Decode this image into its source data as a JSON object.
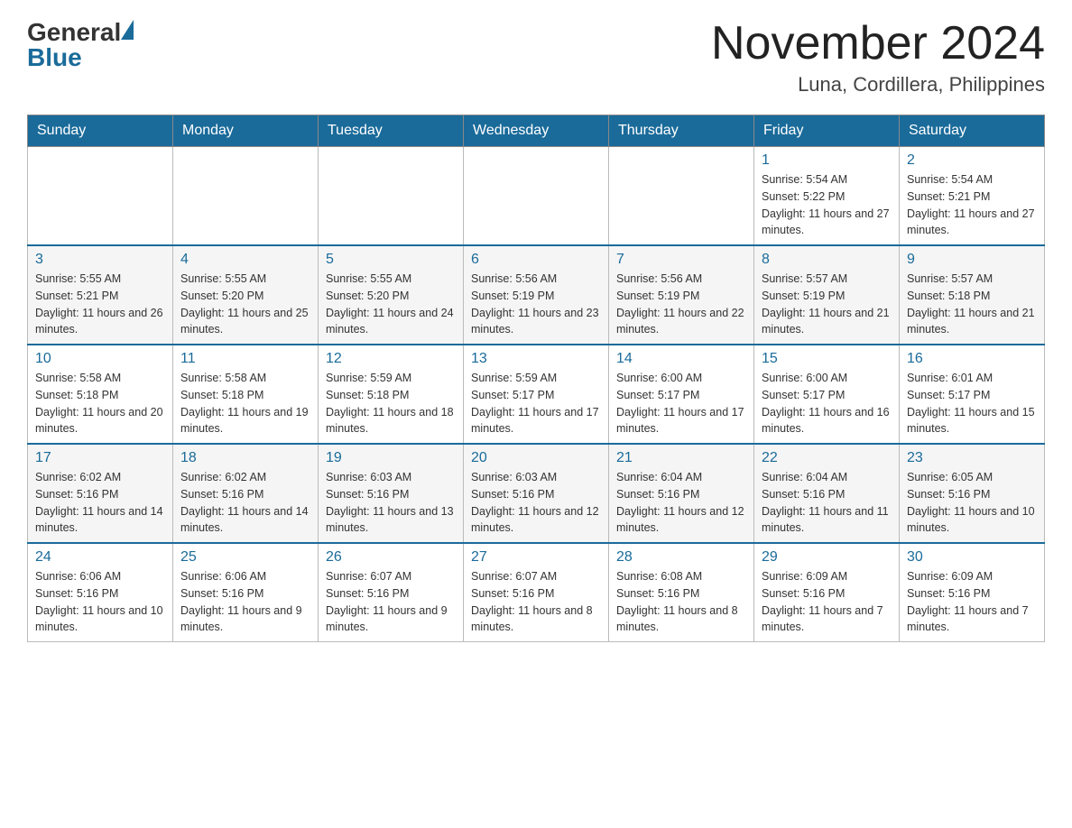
{
  "header": {
    "logo_general": "General",
    "logo_blue": "Blue",
    "month_title": "November 2024",
    "location": "Luna, Cordillera, Philippines"
  },
  "calendar": {
    "days_of_week": [
      "Sunday",
      "Monday",
      "Tuesday",
      "Wednesday",
      "Thursday",
      "Friday",
      "Saturday"
    ],
    "weeks": [
      [
        {
          "day": "",
          "info": ""
        },
        {
          "day": "",
          "info": ""
        },
        {
          "day": "",
          "info": ""
        },
        {
          "day": "",
          "info": ""
        },
        {
          "day": "",
          "info": ""
        },
        {
          "day": "1",
          "info": "Sunrise: 5:54 AM\nSunset: 5:22 PM\nDaylight: 11 hours and 27 minutes."
        },
        {
          "day": "2",
          "info": "Sunrise: 5:54 AM\nSunset: 5:21 PM\nDaylight: 11 hours and 27 minutes."
        }
      ],
      [
        {
          "day": "3",
          "info": "Sunrise: 5:55 AM\nSunset: 5:21 PM\nDaylight: 11 hours and 26 minutes."
        },
        {
          "day": "4",
          "info": "Sunrise: 5:55 AM\nSunset: 5:20 PM\nDaylight: 11 hours and 25 minutes."
        },
        {
          "day": "5",
          "info": "Sunrise: 5:55 AM\nSunset: 5:20 PM\nDaylight: 11 hours and 24 minutes."
        },
        {
          "day": "6",
          "info": "Sunrise: 5:56 AM\nSunset: 5:19 PM\nDaylight: 11 hours and 23 minutes."
        },
        {
          "day": "7",
          "info": "Sunrise: 5:56 AM\nSunset: 5:19 PM\nDaylight: 11 hours and 22 minutes."
        },
        {
          "day": "8",
          "info": "Sunrise: 5:57 AM\nSunset: 5:19 PM\nDaylight: 11 hours and 21 minutes."
        },
        {
          "day": "9",
          "info": "Sunrise: 5:57 AM\nSunset: 5:18 PM\nDaylight: 11 hours and 21 minutes."
        }
      ],
      [
        {
          "day": "10",
          "info": "Sunrise: 5:58 AM\nSunset: 5:18 PM\nDaylight: 11 hours and 20 minutes."
        },
        {
          "day": "11",
          "info": "Sunrise: 5:58 AM\nSunset: 5:18 PM\nDaylight: 11 hours and 19 minutes."
        },
        {
          "day": "12",
          "info": "Sunrise: 5:59 AM\nSunset: 5:18 PM\nDaylight: 11 hours and 18 minutes."
        },
        {
          "day": "13",
          "info": "Sunrise: 5:59 AM\nSunset: 5:17 PM\nDaylight: 11 hours and 17 minutes."
        },
        {
          "day": "14",
          "info": "Sunrise: 6:00 AM\nSunset: 5:17 PM\nDaylight: 11 hours and 17 minutes."
        },
        {
          "day": "15",
          "info": "Sunrise: 6:00 AM\nSunset: 5:17 PM\nDaylight: 11 hours and 16 minutes."
        },
        {
          "day": "16",
          "info": "Sunrise: 6:01 AM\nSunset: 5:17 PM\nDaylight: 11 hours and 15 minutes."
        }
      ],
      [
        {
          "day": "17",
          "info": "Sunrise: 6:02 AM\nSunset: 5:16 PM\nDaylight: 11 hours and 14 minutes."
        },
        {
          "day": "18",
          "info": "Sunrise: 6:02 AM\nSunset: 5:16 PM\nDaylight: 11 hours and 14 minutes."
        },
        {
          "day": "19",
          "info": "Sunrise: 6:03 AM\nSunset: 5:16 PM\nDaylight: 11 hours and 13 minutes."
        },
        {
          "day": "20",
          "info": "Sunrise: 6:03 AM\nSunset: 5:16 PM\nDaylight: 11 hours and 12 minutes."
        },
        {
          "day": "21",
          "info": "Sunrise: 6:04 AM\nSunset: 5:16 PM\nDaylight: 11 hours and 12 minutes."
        },
        {
          "day": "22",
          "info": "Sunrise: 6:04 AM\nSunset: 5:16 PM\nDaylight: 11 hours and 11 minutes."
        },
        {
          "day": "23",
          "info": "Sunrise: 6:05 AM\nSunset: 5:16 PM\nDaylight: 11 hours and 10 minutes."
        }
      ],
      [
        {
          "day": "24",
          "info": "Sunrise: 6:06 AM\nSunset: 5:16 PM\nDaylight: 11 hours and 10 minutes."
        },
        {
          "day": "25",
          "info": "Sunrise: 6:06 AM\nSunset: 5:16 PM\nDaylight: 11 hours and 9 minutes."
        },
        {
          "day": "26",
          "info": "Sunrise: 6:07 AM\nSunset: 5:16 PM\nDaylight: 11 hours and 9 minutes."
        },
        {
          "day": "27",
          "info": "Sunrise: 6:07 AM\nSunset: 5:16 PM\nDaylight: 11 hours and 8 minutes."
        },
        {
          "day": "28",
          "info": "Sunrise: 6:08 AM\nSunset: 5:16 PM\nDaylight: 11 hours and 8 minutes."
        },
        {
          "day": "29",
          "info": "Sunrise: 6:09 AM\nSunset: 5:16 PM\nDaylight: 11 hours and 7 minutes."
        },
        {
          "day": "30",
          "info": "Sunrise: 6:09 AM\nSunset: 5:16 PM\nDaylight: 11 hours and 7 minutes."
        }
      ]
    ]
  }
}
